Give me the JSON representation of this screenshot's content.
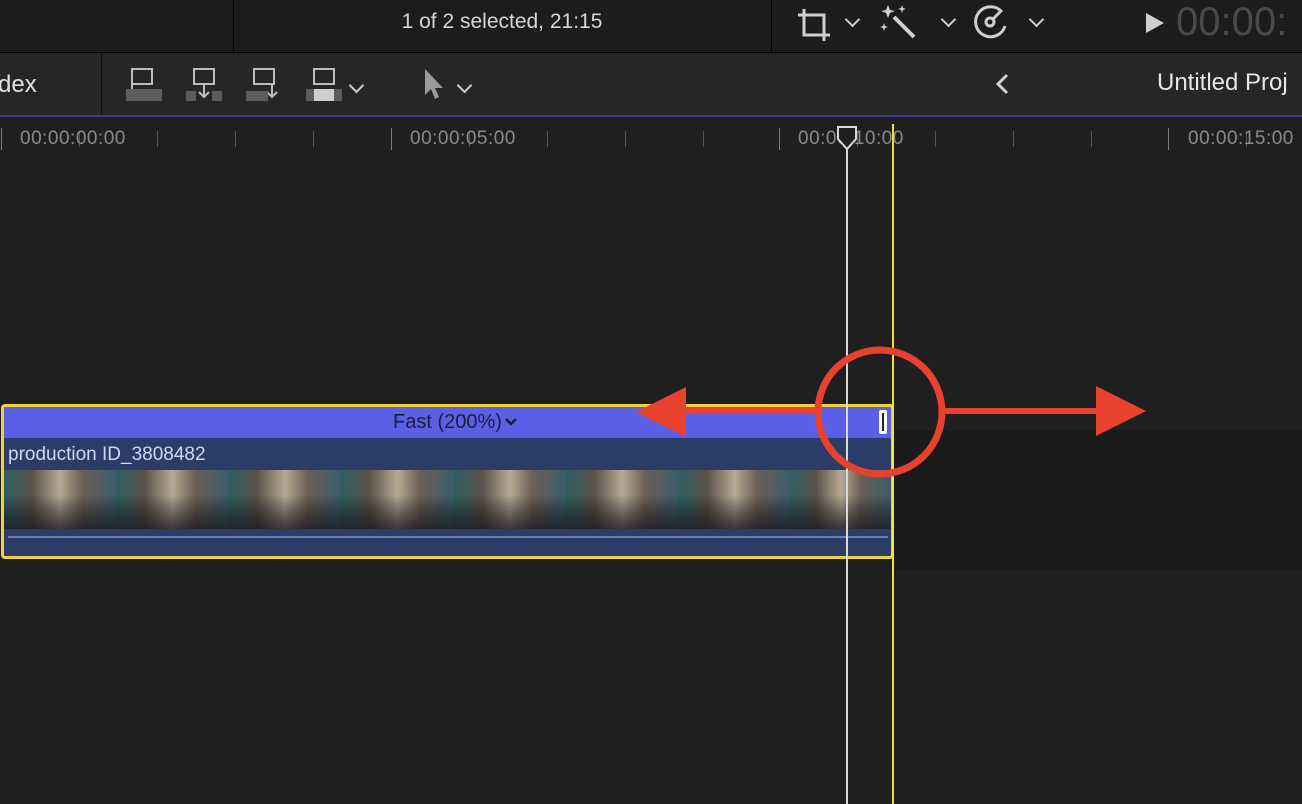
{
  "topbar": {
    "selection_status": "1 of 2 selected, 21:15",
    "timecode": "00:00:",
    "icons": [
      "crop-icon",
      "magic-wand-icon",
      "speed-gauge-icon",
      "play-icon"
    ]
  },
  "toolbar": {
    "index_label": "dex",
    "project_title": "Untitled Proj",
    "icons": [
      "connect-clip-icon",
      "insert-clip-icon",
      "append-clip-icon",
      "overwrite-clip-icon",
      "select-tool-icon",
      "back-chevron-icon"
    ]
  },
  "ruler": {
    "labels": [
      "00:00:00:00",
      "00:00:05:00",
      "00:00:10:00",
      "00:00:15:00"
    ]
  },
  "clip": {
    "speed_label": "Fast (200%)",
    "title": "production ID_3808482"
  },
  "annotation": {
    "color": "#e8412e",
    "shapes": [
      "circle",
      "double-arrow"
    ]
  },
  "colors": {
    "speed_bar": "#5b5fe6",
    "clip_border": "#f2d23a",
    "skimmer": "#f3e03a",
    "playhead": "#d9d9d9"
  }
}
